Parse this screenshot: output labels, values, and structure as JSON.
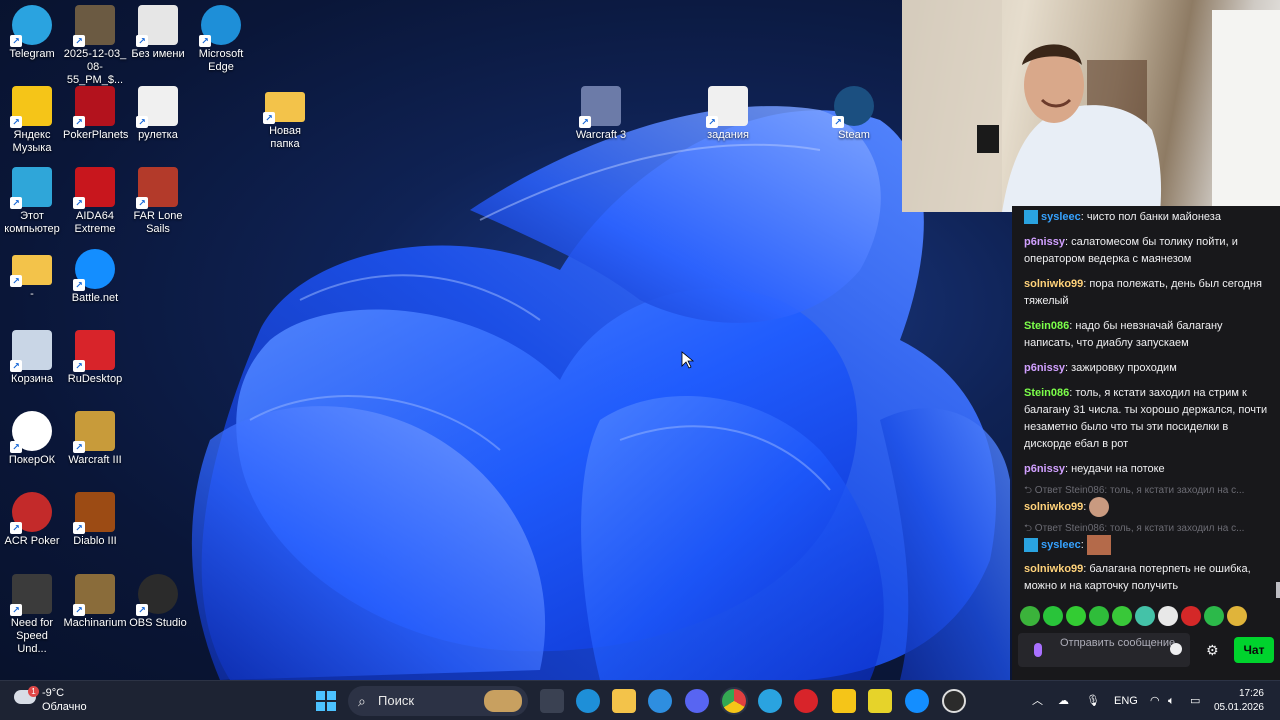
{
  "desktop": {
    "icons": [
      {
        "label": "Telegram",
        "icon": "telegram-icon",
        "color": "#2aa3e0"
      },
      {
        "label": "2025-12-03_\n08-55_PM_$...",
        "icon": "screenshot-file-icon",
        "color": "#6b5a42"
      },
      {
        "label": "Без имени",
        "icon": "image-file-icon",
        "color": "#e6e6e6"
      },
      {
        "label": "Microsoft\nEdge",
        "icon": "edge-icon",
        "color": "#1e8fd8"
      },
      {
        "label": "Яндекс\nМузыка",
        "icon": "yandex-music-icon",
        "color": "#f5c518"
      },
      {
        "label": "PokerPlanets",
        "icon": "pokerplanets-icon",
        "color": "#b3121d"
      },
      {
        "label": "рулетка",
        "icon": "roulette-file-icon",
        "color": "#f0f0f0"
      },
      {
        "label": "Новая папка",
        "icon": "folder-icon",
        "color": "#f3c34a"
      },
      {
        "label": "Этот\nкомпьютер",
        "icon": "computer-icon",
        "color": "#2fa6d9"
      },
      {
        "label": "AIDA64\nExtreme",
        "icon": "aida64-icon",
        "color": "#c8161d"
      },
      {
        "label": "FAR Lone\nSails",
        "icon": "far-lone-sails-icon",
        "color": "#b33a2a"
      },
      {
        "label": "-",
        "icon": "folder-icon",
        "color": "#f3c34a"
      },
      {
        "label": "Battle.net",
        "icon": "battlenet-icon",
        "color": "#148eff"
      },
      {
        "label": "Корзина",
        "icon": "recycle-bin-icon",
        "color": "#c9d6e6"
      },
      {
        "label": "RuDesktop",
        "icon": "rudesktop-icon",
        "color": "#d8242a"
      },
      {
        "label": "ПокерОК",
        "icon": "pokerok-icon",
        "color": "#ffffff"
      },
      {
        "label": "Warcraft III",
        "icon": "warcraft3-icon",
        "color": "#c89b3a"
      },
      {
        "label": "ACR Poker",
        "icon": "acr-poker-icon",
        "color": "#c32a2a"
      },
      {
        "label": "Diablo III",
        "icon": "diablo3-icon",
        "color": "#9c4b14"
      },
      {
        "label": "Need for\nSpeed Und...",
        "icon": "nfs-icon",
        "color": "#3b3b3b"
      },
      {
        "label": "Machinarium",
        "icon": "machinarium-icon",
        "color": "#8a6c3a"
      },
      {
        "label": "OBS Studio",
        "icon": "obs-icon",
        "color": "#2b2b2b"
      },
      {
        "label": "Warcraft 3",
        "icon": "warcraft3-icon",
        "color": "#6c7ba8"
      },
      {
        "label": "задания",
        "icon": "text-file-icon",
        "color": "#f0f0f0"
      },
      {
        "label": "Steam",
        "icon": "steam-icon",
        "color": "#1b4f80"
      }
    ]
  },
  "chat": {
    "messages": [
      {
        "user": "sysleec",
        "color": "#36a2ff",
        "text": ": чисто пол банки майонеза",
        "badge": true
      },
      {
        "user": "p6nissy",
        "color": "#d1a0ff",
        "text": ": салатомесом бы толику пойти, и оператором ведерка с маянезом"
      },
      {
        "user": "solniwko99",
        "color": "#ffd27a",
        "text": ": пора полежать, день был сегодня тяжелый"
      },
      {
        "user": "Stein086",
        "color": "#7cff4a",
        "text": ": надо бы невзначай балагану написать, что диаблу запускаем"
      },
      {
        "user": "p6nissy",
        "color": "#d1a0ff",
        "text": ": зажировку проходим"
      },
      {
        "user": "Stein086",
        "color": "#7cff4a",
        "text": ": толь, я кстати заходил на стрим к балагану 31 числа. ты хорошо держался, почти незаметно было что ты эти посиделки в дискорде ебал в рот"
      },
      {
        "user": "p6nissy",
        "color": "#d1a0ff",
        "text": ": неудачи на потоке"
      }
    ],
    "reply1": "Ответ Stein086: толь, я кстати заходил на с...",
    "reply1_user": "solniwko99",
    "reply1_user_color": "#ffd27a",
    "reply2": "Ответ Stein086: толь, я кстати заходил на с...",
    "reply2_user": "sysleec",
    "reply2_user_color": "#36a2ff",
    "last": {
      "user": "solniwko99",
      "color": "#ffd27a",
      "text": ": балагана потерпеть не ошибка, можно и на карточку получить"
    },
    "input_placeholder": "Отправить сообщение",
    "send_label": "Чат"
  },
  "taskbar": {
    "weather_temp": "-9°C",
    "weather_desc": "Облачно",
    "weather_badge": "1",
    "search_label": "Поиск",
    "language": "ENG",
    "time": "17:26",
    "date": "05.01.2026",
    "pinned": [
      "windows-start-icon",
      "widgets-icon",
      "task-view-icon",
      "edge-icon",
      "file-explorer-icon",
      "cortana-icon",
      "discord-icon",
      "chrome-icon",
      "telegram-icon",
      "rudesktop-icon",
      "yandex-music-icon",
      "battery-app-icon",
      "battlenet-icon",
      "obs-icon"
    ]
  }
}
